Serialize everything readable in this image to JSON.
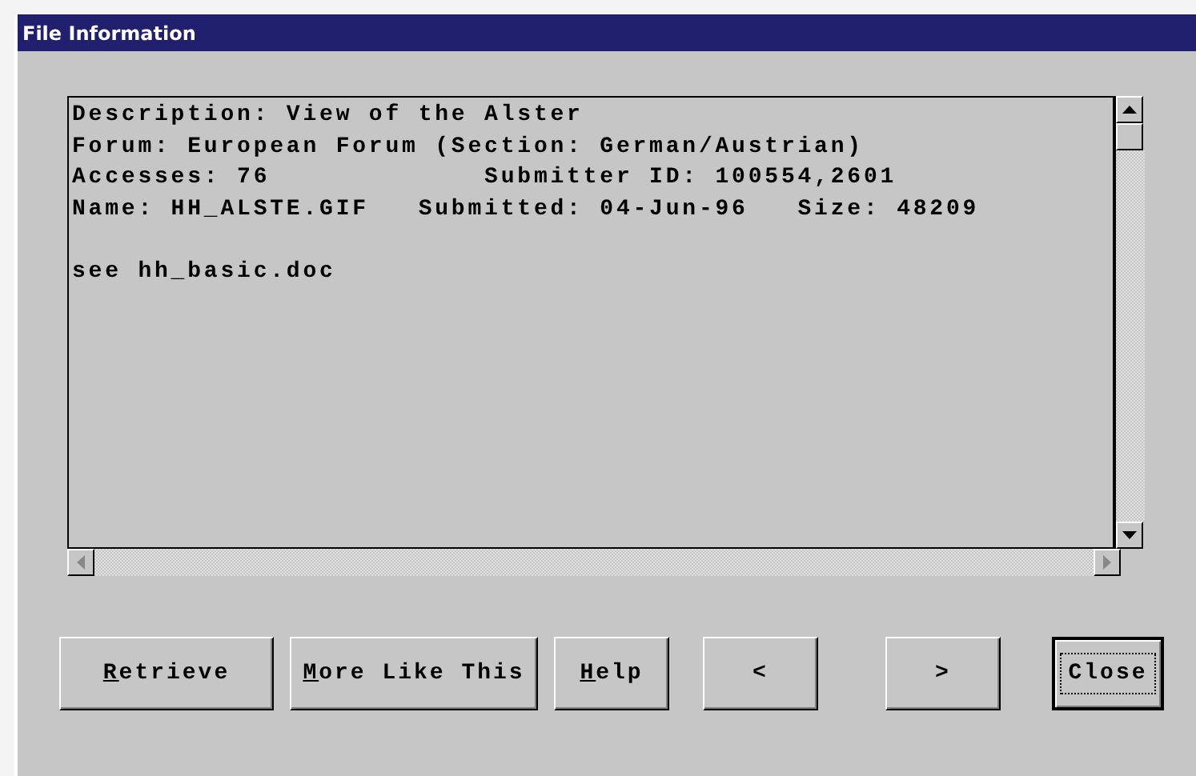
{
  "window": {
    "title": "File Information"
  },
  "details": {
    "lines": [
      "Description: View of the Alster",
      "Forum: European Forum (Section: German/Austrian)",
      "Accesses: 76             Submitter ID: 100554,2601",
      "Name: HH_ALSTE.GIF   Submitted: 04-Jun-96   Size: 48209"
    ],
    "note": "see hh_basic.doc"
  },
  "buttons": [
    {
      "label": "Retrieve",
      "access_key": true,
      "default": false
    },
    {
      "label": "More Like This",
      "access_key": true,
      "default": false
    },
    {
      "label": "Help",
      "access_key": true,
      "default": false
    },
    {
      "label": "<",
      "access_key": false,
      "default": false
    },
    {
      "label": ">",
      "access_key": false,
      "default": false
    },
    {
      "label": "Close",
      "access_key": false,
      "default": true
    }
  ]
}
